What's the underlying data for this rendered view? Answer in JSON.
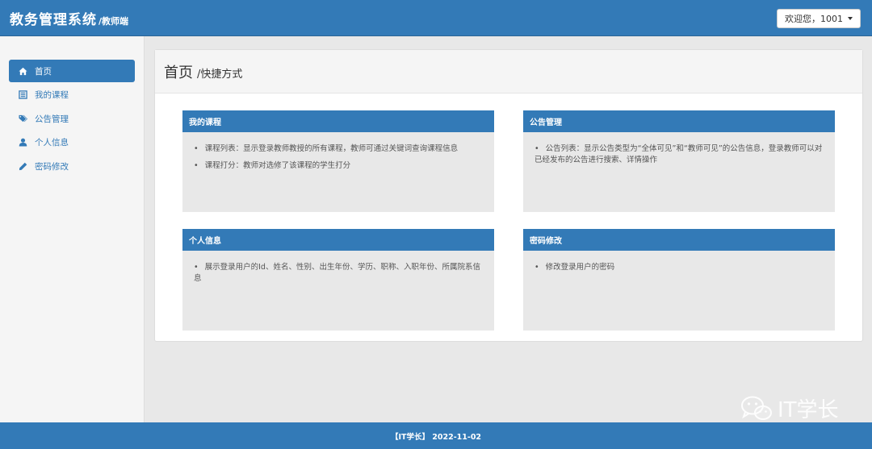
{
  "header": {
    "title": "教务管理系统",
    "subtitle": "/教师端",
    "user_label": "欢迎您，1001"
  },
  "sidebar": {
    "items": [
      {
        "label": "首页",
        "icon": "home-icon",
        "active": true
      },
      {
        "label": "我的课程",
        "icon": "list-icon",
        "active": false
      },
      {
        "label": "公告管理",
        "icon": "tags-icon",
        "active": false
      },
      {
        "label": "个人信息",
        "icon": "user-icon",
        "active": false
      },
      {
        "label": "密码修改",
        "icon": "pencil-icon",
        "active": false
      }
    ]
  },
  "main": {
    "title": "首页",
    "subtitle": "/快捷方式",
    "cards": [
      {
        "title": "我的课程",
        "items": [
          "课程列表：显示登录教师教授的所有课程，教师可通过关键词查询课程信息",
          "课程打分：教师对选修了该课程的学生打分"
        ]
      },
      {
        "title": "公告管理",
        "items": [
          "公告列表：显示公告类型为“全体可见”和“教师可见”的公告信息，登录教师可以对已经发布的公告进行搜索、详情操作"
        ]
      },
      {
        "title": "个人信息",
        "items": [
          "展示登录用户的Id、姓名、性别、出生年份、学历、职称、入职年份、所属院系信息"
        ]
      },
      {
        "title": "密码修改",
        "items": [
          "修改登录用户的密码"
        ]
      }
    ]
  },
  "watermark": {
    "text": "IT学长"
  },
  "footer": {
    "text": "【IT学长】 2022-11-02"
  },
  "colors": {
    "primary": "#337ab7",
    "card_bg": "#e8e8e8",
    "page_bg": "#e8e8e8"
  }
}
